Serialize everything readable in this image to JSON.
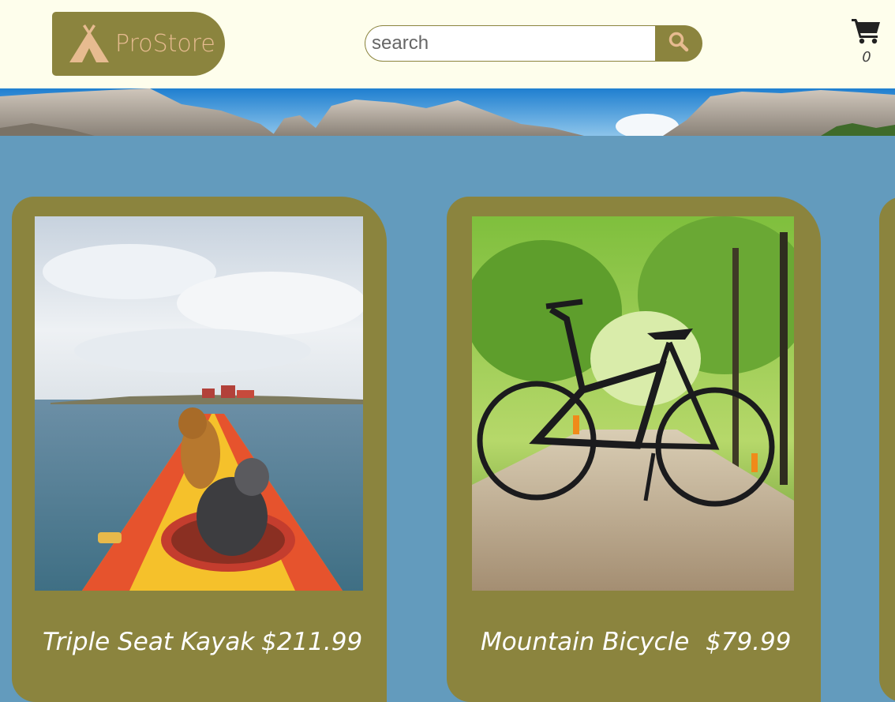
{
  "header": {
    "logo_text": "ProStore",
    "search": {
      "placeholder": "search",
      "value": ""
    },
    "cart": {
      "count": "0"
    }
  },
  "products": [
    {
      "title": "Triple Seat Kayak",
      "price": "$211.99"
    },
    {
      "title": "Mountain Bicycle",
      "price": "$79.99"
    }
  ],
  "colors": {
    "header_bg": "#fefeec",
    "accent": "#8b843e",
    "page_bg": "#639bbd",
    "logo_text": "#e7bb90"
  },
  "icons": {
    "logo": "tent-icon",
    "search": "search-icon",
    "cart": "cart-icon"
  }
}
